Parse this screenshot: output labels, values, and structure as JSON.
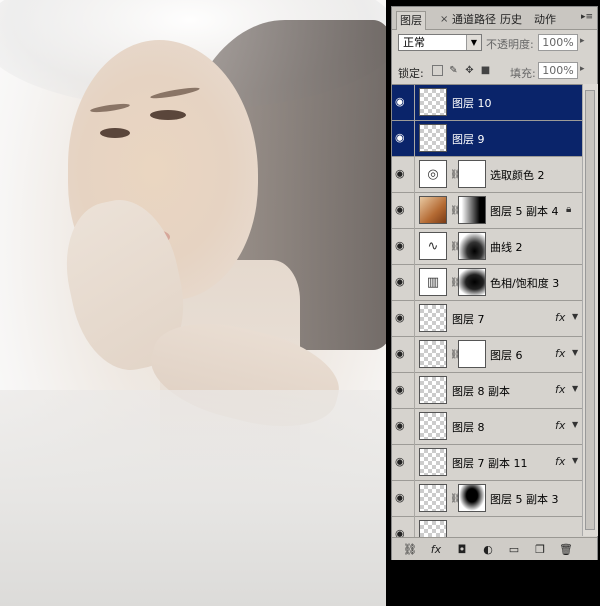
{
  "photo": {
    "description_hidden": ""
  },
  "panel": {
    "tabs": [
      "图层",
      "通道",
      "路径",
      "历史",
      "动作"
    ],
    "close_glyph": "×",
    "menu_glyph": "▸≡",
    "blend_mode": "正常",
    "opacity_label": "不透明度:",
    "opacity_value": "100%",
    "lock_label": "锁定:",
    "fill_label": "填充:",
    "fill_value": "100%"
  },
  "layers": [
    {
      "name": "图层 10",
      "selected": true,
      "fx": false
    },
    {
      "name": "图层 9",
      "selected": true,
      "fx": false
    },
    {
      "name": "选取颜色 2",
      "selected": false,
      "fx": false
    },
    {
      "name": "图层 5 副本 4",
      "selected": false,
      "fx": false
    },
    {
      "name": "曲线 2",
      "selected": false,
      "fx": false
    },
    {
      "name": "色相/饱和度 3",
      "selected": false,
      "fx": false
    },
    {
      "name": "图层 7",
      "selected": false,
      "fx": true
    },
    {
      "name": "图层 6",
      "selected": false,
      "fx": true
    },
    {
      "name": "图层 8 副本",
      "selected": false,
      "fx": true
    },
    {
      "name": "图层 8",
      "selected": false,
      "fx": true
    },
    {
      "name": "图层 7 副本 11",
      "selected": false,
      "fx": true
    },
    {
      "name": "图层 5 副本 3",
      "selected": false,
      "fx": false
    }
  ],
  "fx_label": "fx",
  "colors": {
    "selection": "#0a246a",
    "panel_bg": "#d6d3ce"
  }
}
